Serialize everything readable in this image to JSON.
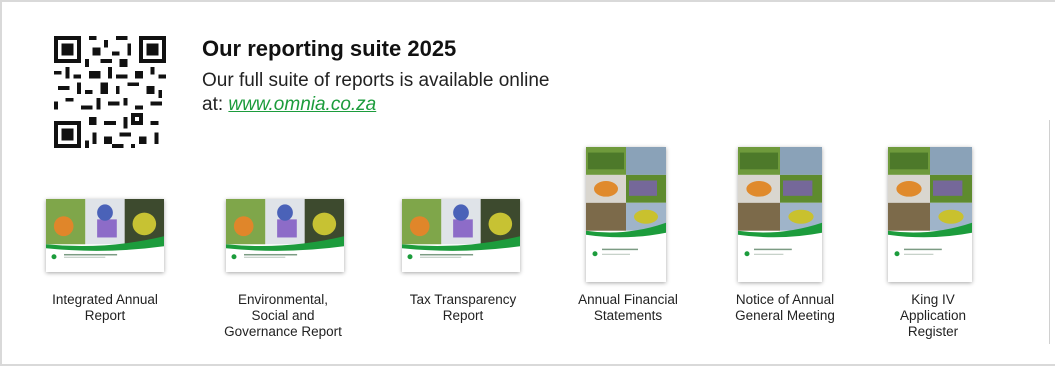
{
  "header": {
    "title": "Our reporting suite 2025",
    "subtitle_prefix": "Our full suite of reports is available online at:",
    "link_text": "www.omnia.co.za"
  },
  "colors": {
    "accent_green": "#1c9c3c",
    "border": "#d9d9d9"
  },
  "icons": {
    "qr": "qr-code-icon",
    "cover_logo": "omnia-logo-icon"
  },
  "reports": [
    {
      "lines": [
        "Integrated Annual",
        "Report"
      ],
      "orientation": "landscape"
    },
    {
      "lines": [
        "Environmental,",
        "Social and",
        "Governance Report"
      ],
      "orientation": "landscape"
    },
    {
      "lines": [
        "Tax Transparency",
        "Report"
      ],
      "orientation": "landscape"
    },
    {
      "lines": [
        "Annual Financial",
        "Statements"
      ],
      "orientation": "portrait"
    },
    {
      "lines": [
        "Notice of Annual",
        "General Meeting"
      ],
      "orientation": "portrait"
    },
    {
      "lines": [
        "King IV",
        "Application",
        "Register"
      ],
      "orientation": "portrait"
    }
  ]
}
